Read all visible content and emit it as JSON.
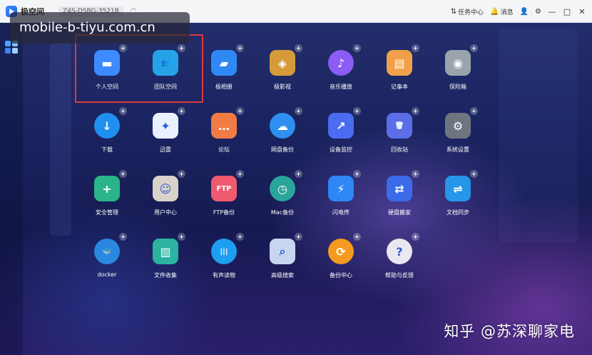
{
  "topbar": {
    "brand": "极空间",
    "device": "Z4S-DSBG-3521B",
    "wifi_icon": "wifi-icon",
    "task_center": "任务中心",
    "messages": "消息",
    "user_icon": "user-icon",
    "settings_icon": "gear-icon",
    "minimize": "—",
    "maximize": "□",
    "close": "✕"
  },
  "overlay": {
    "url": "mobile-b-tiyu.com.cn"
  },
  "apps": [
    {
      "label": "个人空间",
      "icon": "folder-icon",
      "color": "#3d8bff",
      "glyph": "▬"
    },
    {
      "label": "团队空间",
      "icon": "team-folder-icon",
      "color": "#26a3e8",
      "glyph": "👥"
    },
    {
      "label": "极相册",
      "icon": "photo-album-icon",
      "color": "#2f89f5",
      "glyph": "▰"
    },
    {
      "label": "极影视",
      "icon": "video-icon",
      "color": "#d69a3a",
      "glyph": "◈"
    },
    {
      "label": "音乐播放",
      "icon": "music-icon",
      "color": "#8b5cf6",
      "glyph": "♪"
    },
    {
      "label": "记事本",
      "icon": "notepad-icon",
      "color": "#f0a04b",
      "glyph": "▤"
    },
    {
      "label": "保险箱",
      "icon": "safe-icon",
      "color": "#9aa4ad",
      "glyph": "◉"
    },
    {
      "label": "下载",
      "icon": "download-icon",
      "color": "#1f8ff0",
      "glyph": "↓"
    },
    {
      "label": "迅雷",
      "icon": "thunder-icon",
      "color": "#e9f1ff",
      "glyph": "✦"
    },
    {
      "label": "论坛",
      "icon": "forum-icon",
      "color": "#f07b45",
      "glyph": "…"
    },
    {
      "label": "网盘备份",
      "icon": "cloud-backup-icon",
      "color": "#2e8ff0",
      "glyph": "☁"
    },
    {
      "label": "设备监控",
      "icon": "monitor-icon",
      "color": "#4b6cf0",
      "glyph": "↗"
    },
    {
      "label": "回收站",
      "icon": "trash-icon",
      "color": "#5b6ee8",
      "glyph": "🗑"
    },
    {
      "label": "系统设置",
      "icon": "settings-icon",
      "color": "#6d7680",
      "glyph": "⚙"
    },
    {
      "label": "安全管理",
      "icon": "shield-icon",
      "color": "#2bb38a",
      "glyph": "+"
    },
    {
      "label": "用户中心",
      "icon": "user-center-icon",
      "color": "#d9d2c8",
      "glyph": "☺"
    },
    {
      "label": "FTP备份",
      "icon": "ftp-icon",
      "color": "#ef5a6f",
      "glyph": "FTP"
    },
    {
      "label": "Mac备份",
      "icon": "mac-backup-icon",
      "color": "#2aa59a",
      "glyph": "◷"
    },
    {
      "label": "闪电传",
      "icon": "lightning-icon",
      "color": "#2f86f5",
      "glyph": "⚡"
    },
    {
      "label": "硬盘搬家",
      "icon": "disk-move-icon",
      "color": "#3b6be8",
      "glyph": "⇄"
    },
    {
      "label": "文档同步",
      "icon": "doc-sync-icon",
      "color": "#2596e8",
      "glyph": "⇌"
    },
    {
      "label": "docker",
      "icon": "docker-icon",
      "color": "#2a88e0",
      "glyph": "🐳"
    },
    {
      "label": "文件收集",
      "icon": "file-collect-icon",
      "color": "#2bb3a0",
      "glyph": "▥"
    },
    {
      "label": "有声读物",
      "icon": "audiobook-icon",
      "color": "#1e9ef0",
      "glyph": "|||"
    },
    {
      "label": "高级搜索",
      "icon": "advanced-search-icon",
      "color": "#c8d4f0",
      "glyph": "⌕"
    },
    {
      "label": "备份中心",
      "icon": "backup-center-icon",
      "color": "#f59a1e",
      "glyph": "⟳"
    },
    {
      "label": "帮助与反馈",
      "icon": "help-icon",
      "color": "#e8e8ee",
      "glyph": "?"
    }
  ],
  "watermark": "知乎 @苏深聊家电"
}
